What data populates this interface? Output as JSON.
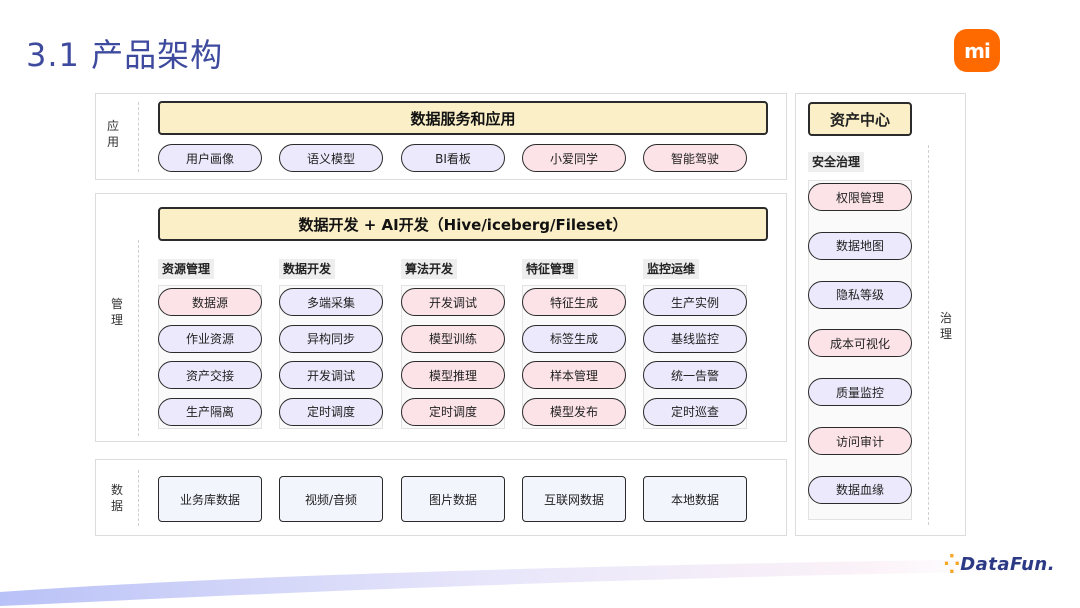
{
  "title": "3.1 产品架构",
  "logo_text": "mi",
  "brand_footer": "DataFun.",
  "colors": {
    "title": "#3e4a9e",
    "banner": "#fbefc8",
    "pill_purple": "#ebe9fb",
    "pill_pink": "#fce3e8",
    "data_box": "#f3f5fd",
    "logo": "#ff6a00"
  },
  "application": {
    "side_label": "应用",
    "banner": "数据服务和应用",
    "items": [
      {
        "label": "用户画像",
        "tone": "purple"
      },
      {
        "label": "语义模型",
        "tone": "purple"
      },
      {
        "label": "BI看板",
        "tone": "purple"
      },
      {
        "label": "小爱同学",
        "tone": "pink"
      },
      {
        "label": "智能驾驶",
        "tone": "pink"
      }
    ]
  },
  "management": {
    "side_label": "管理",
    "banner": "数据开发 + AI开发（Hive/iceberg/Fileset）",
    "groups": [
      {
        "label": "资源管理",
        "items": [
          {
            "label": "数据源",
            "tone": "pink"
          },
          {
            "label": "作业资源",
            "tone": "purple"
          },
          {
            "label": "资产交接",
            "tone": "purple"
          },
          {
            "label": "生产隔离",
            "tone": "purple"
          }
        ]
      },
      {
        "label": "数据开发",
        "items": [
          {
            "label": "多端采集",
            "tone": "purple"
          },
          {
            "label": "异构同步",
            "tone": "purple"
          },
          {
            "label": "开发调试",
            "tone": "purple"
          },
          {
            "label": "定时调度",
            "tone": "purple"
          }
        ]
      },
      {
        "label": "算法开发",
        "items": [
          {
            "label": "开发调试",
            "tone": "pink"
          },
          {
            "label": "模型训练",
            "tone": "pink"
          },
          {
            "label": "模型推理",
            "tone": "pink"
          },
          {
            "label": "定时调度",
            "tone": "pink"
          }
        ]
      },
      {
        "label": "特征管理",
        "items": [
          {
            "label": "特征生成",
            "tone": "pink"
          },
          {
            "label": "标签生成",
            "tone": "purple"
          },
          {
            "label": "样本管理",
            "tone": "pink"
          },
          {
            "label": "模型发布",
            "tone": "pink"
          }
        ]
      },
      {
        "label": "监控运维",
        "items": [
          {
            "label": "生产实例",
            "tone": "purple"
          },
          {
            "label": "基线监控",
            "tone": "purple"
          },
          {
            "label": "统一告警",
            "tone": "purple"
          },
          {
            "label": "定时巡查",
            "tone": "purple"
          }
        ]
      }
    ]
  },
  "data_layer": {
    "side_label": "数据",
    "items": [
      "业务库数据",
      "视频/音频",
      "图片数据",
      "互联网数据",
      "本地数据"
    ]
  },
  "governance": {
    "header": "资产中心",
    "group_label": "安全治理",
    "side_label": "治理",
    "items": [
      {
        "label": "权限管理",
        "tone": "pink"
      },
      {
        "label": "数据地图",
        "tone": "purple"
      },
      {
        "label": "隐私等级",
        "tone": "purple"
      },
      {
        "label": "成本可视化",
        "tone": "pink"
      },
      {
        "label": "质量监控",
        "tone": "purple"
      },
      {
        "label": "访问审计",
        "tone": "pink"
      },
      {
        "label": "数据血缘",
        "tone": "purple"
      }
    ]
  }
}
